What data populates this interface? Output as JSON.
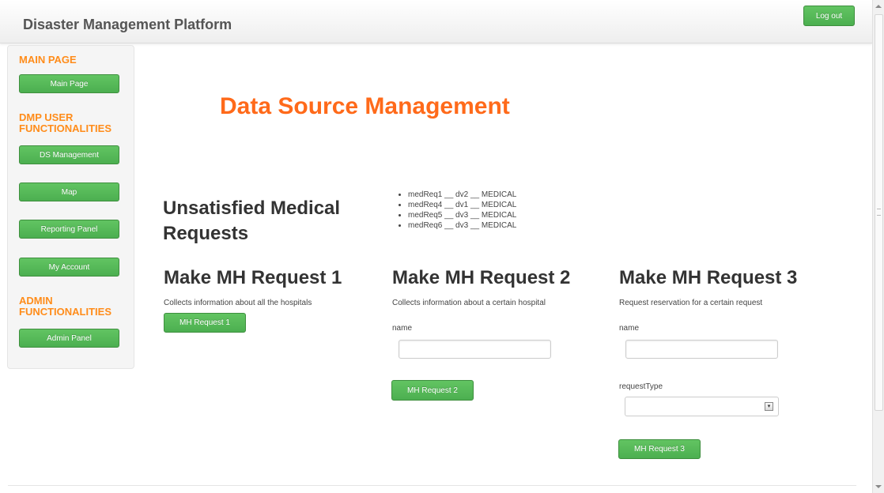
{
  "header": {
    "title": "Disaster Management Platform",
    "logout_label": "Log out"
  },
  "sidebar": {
    "sections": [
      {
        "heading": "MAIN PAGE"
      },
      {
        "heading": "DMP USER FUNCTIONALITIES"
      },
      {
        "heading": "ADMIN FUNCTIONALITIES"
      }
    ],
    "items": [
      {
        "label": "Main Page"
      },
      {
        "label": "DS Management"
      },
      {
        "label": "Map"
      },
      {
        "label": "Reporting Panel"
      },
      {
        "label": "My Account"
      },
      {
        "label": "Admin Panel"
      }
    ]
  },
  "main": {
    "page_title": "Data Source Management",
    "unsatisfied_heading": "Unsatisfied Medical Requests",
    "requests": [
      "medReq1 __ dv2 __ MEDICAL",
      "medReq4 __ dv1 __ MEDICAL",
      "medReq5 __ dv3 __ MEDICAL",
      "medReq6 __ dv3 __ MEDICAL"
    ],
    "columns": [
      {
        "title": "Make MH Request 1",
        "description": "Collects information about all the hospitals",
        "button_label": "MH Request 1"
      },
      {
        "title": "Make MH Request 2",
        "description": "Collects information about a certain hospital",
        "name_label": "name",
        "name_value": "",
        "button_label": "MH Request 2"
      },
      {
        "title": "Make MH Request 3",
        "description": "Request reservation for a certain request",
        "name_label": "name",
        "name_value": "",
        "type_label": "requestType",
        "type_value": "",
        "button_label": "MH Request 3"
      }
    ]
  },
  "colors": {
    "accent_orange": "#ff6a1a",
    "button_green": "#4caf50"
  }
}
